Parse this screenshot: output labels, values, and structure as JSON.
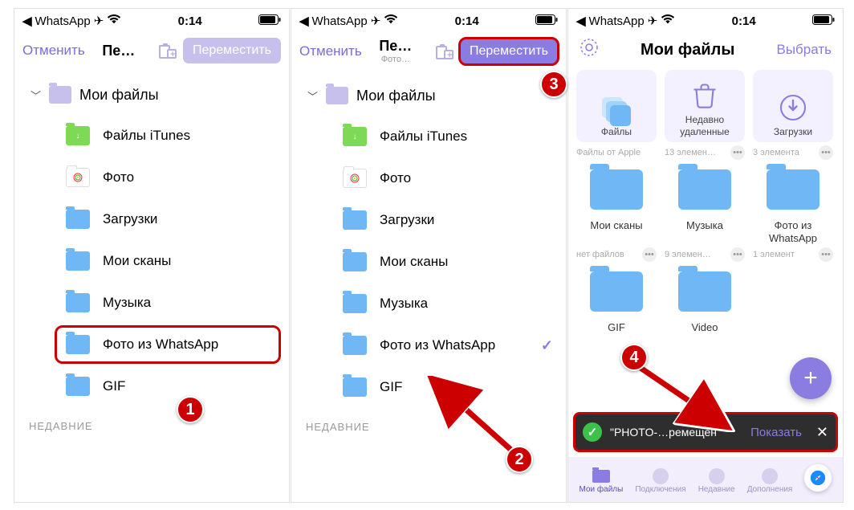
{
  "status": {
    "back_app": "WhatsApp",
    "time": "0:14"
  },
  "panel1": {
    "cancel": "Отменить",
    "title": "Пе…",
    "move": "Переместить",
    "root": "Мои файлы",
    "folders": [
      {
        "label": "Файлы iTunes"
      },
      {
        "label": "Фото"
      },
      {
        "label": "Загрузки"
      },
      {
        "label": "Мои сканы"
      },
      {
        "label": "Музыка"
      },
      {
        "label": "Фото из  WhatsApp"
      },
      {
        "label": "GIF"
      }
    ],
    "section": "НЕДАВНИЕ"
  },
  "panel2": {
    "cancel": "Отменить",
    "title": "Пе…",
    "subtitle": "Фото…",
    "move": "Переместить",
    "root": "Мои файлы",
    "folders": [
      {
        "label": "Файлы iTunes"
      },
      {
        "label": "Фото"
      },
      {
        "label": "Загрузки"
      },
      {
        "label": "Мои сканы"
      },
      {
        "label": "Музыка"
      },
      {
        "label": "Фото из  WhatsApp",
        "checked": true
      },
      {
        "label": "GIF"
      }
    ],
    "section": "НЕДАВНИЕ"
  },
  "panel3": {
    "title": "Мои файлы",
    "select": "Выбрать",
    "row1": [
      {
        "name": "Файлы",
        "sub": "Файлы от Apple",
        "light": true,
        "fileicon": true
      },
      {
        "name": "Недавно удаленные",
        "sub": "13 элемен…",
        "light": true
      },
      {
        "name": "Загрузки",
        "sub": "3 элемента",
        "light": true
      }
    ],
    "row2": [
      {
        "name": "Мои сканы",
        "sub": "нет файлов"
      },
      {
        "name": "Музыка",
        "sub": "9 элемен…"
      },
      {
        "name": "Фото из WhatsApp",
        "sub": "1 элемент"
      }
    ],
    "row3": [
      {
        "name": "GIF"
      },
      {
        "name": "Video"
      }
    ],
    "toast": {
      "msg": "\"PHOTO-…ремещен",
      "show": "Показать"
    },
    "tabs": {
      "t1": "Мои файлы",
      "t2": "Подключения",
      "t3": "Недавние",
      "t4": "Дополнения"
    }
  },
  "badges": {
    "b1": "1",
    "b2": "2",
    "b3": "3",
    "b4": "4"
  }
}
